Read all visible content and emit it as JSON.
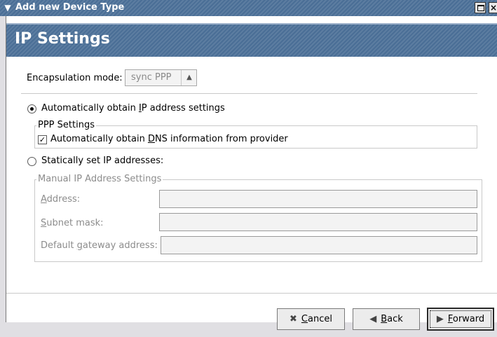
{
  "window": {
    "title": "Add new Device Type"
  },
  "banner": {
    "title": "IP Settings"
  },
  "encapsulation": {
    "label_pre": "Encapsulation mode:",
    "value": "sync PPP"
  },
  "auto_ip": {
    "label_pre": "Automatically obtain ",
    "label_mnemonic": "I",
    "label_post": "P address settings",
    "selected": true
  },
  "ppp_settings": {
    "legend": "PPP Settings",
    "dns_pre": "Automatically obtain ",
    "dns_mnemonic": "D",
    "dns_post": "NS information from provider",
    "dns_checked": true
  },
  "static_ip": {
    "label": "Statically set IP addresses:",
    "selected": false
  },
  "manual": {
    "legend": "Manual IP Address Settings",
    "address_mnemonic": "A",
    "address_rest": "ddress:",
    "subnet_mnemonic": "S",
    "subnet_rest": "ubnet mask:",
    "gateway_pre": "Default ",
    "gateway_mnemonic": "g",
    "gateway_post": "ateway address:",
    "address_value": "",
    "subnet_value": "",
    "gateway_value": ""
  },
  "buttons": {
    "cancel_mnemonic": "C",
    "cancel_rest": "ancel",
    "back_mnemonic": "B",
    "back_rest": "ack",
    "forward_mnemonic": "F",
    "forward_rest": "orward"
  }
}
